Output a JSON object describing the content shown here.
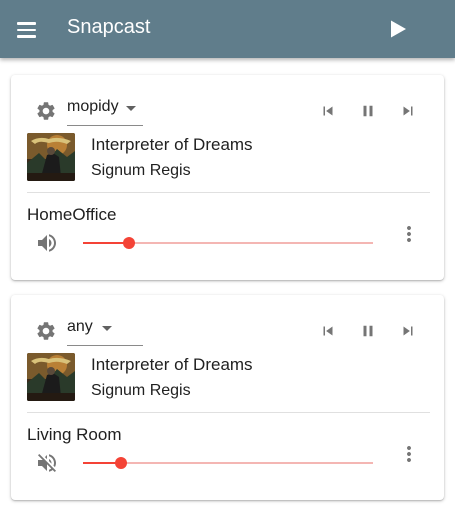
{
  "app": {
    "title": "Snapcast"
  },
  "colors": {
    "appbar": "#607d8b",
    "accent": "#f44336",
    "rail": "#f4b6b3",
    "icon": "#757575"
  },
  "groups": [
    {
      "stream": "mopidy",
      "track": {
        "title": "Interpreter of Dreams",
        "artist": "Signum Regis"
      },
      "client": {
        "name": "HomeOffice",
        "volume": 0.16,
        "muted": false
      }
    },
    {
      "stream": "any",
      "track": {
        "title": "Interpreter of Dreams",
        "artist": "Signum Regis"
      },
      "client": {
        "name": "Living Room",
        "volume": 0.13,
        "muted": true
      }
    }
  ]
}
